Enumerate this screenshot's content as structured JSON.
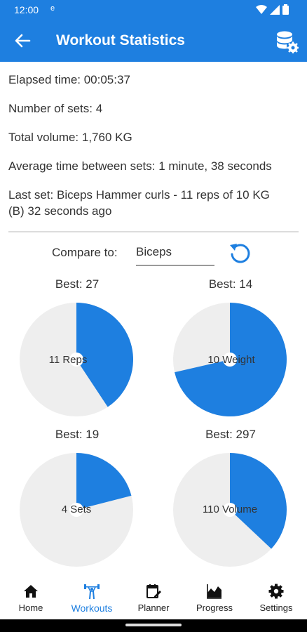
{
  "status": {
    "time": "12:00",
    "indicator": "e"
  },
  "appbar": {
    "title": "Workout Statistics",
    "back_icon": "arrow-left-icon",
    "action_icon": "database-settings-icon"
  },
  "stats": {
    "elapsed": "Elapsed time: 00:05:37",
    "sets": "Number of sets: 4",
    "volume": "Total volume: 1,760 KG",
    "avg_time": "Average time between sets: 1 minute, 38 seconds",
    "last_set_line1": "Last set: Biceps Hammer curls - 11 reps of 10 KG",
    "last_set_line2": "(B) 32 seconds ago"
  },
  "compare": {
    "label": "Compare to:",
    "value": "Biceps"
  },
  "charts": [
    {
      "best": "Best: 27",
      "label": "11 Reps",
      "fraction": 0.407
    },
    {
      "best": "Best: 14",
      "label": "10 Weight",
      "fraction": 0.714
    },
    {
      "best": "Best: 19",
      "label": "4 Sets",
      "fraction": 0.21
    },
    {
      "best": "Best: 297",
      "label": "110 Volume",
      "fraction": 0.37
    }
  ],
  "colors": {
    "accent": "#1e7fe0",
    "pie_background": "#eeeeee"
  },
  "nav": {
    "home": "Home",
    "workouts": "Workouts",
    "planner": "Planner",
    "progress": "Progress",
    "settings": "Settings"
  }
}
